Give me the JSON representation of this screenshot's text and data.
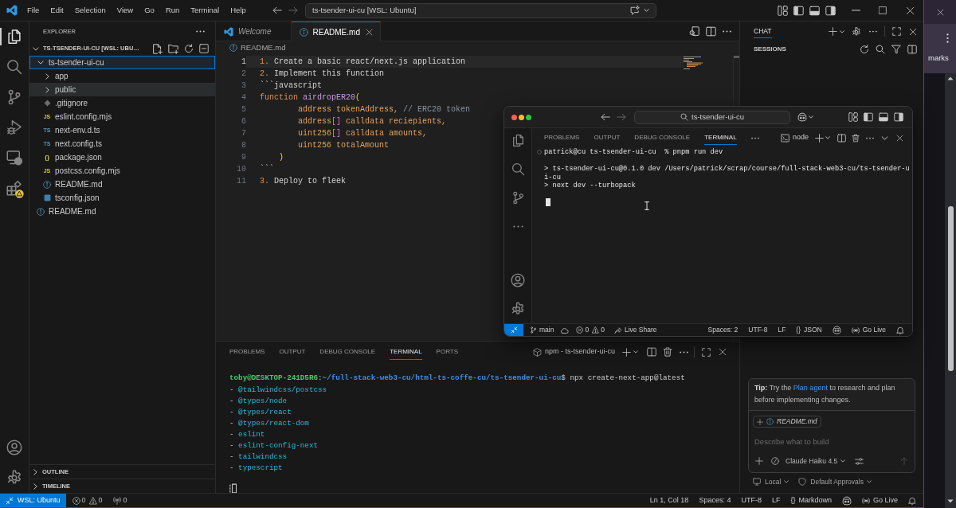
{
  "title_bar": {
    "menu": [
      "File",
      "Edit",
      "Selection",
      "View",
      "Go",
      "Run",
      "Terminal",
      "Help"
    ],
    "command_center": "ts-tsender-ui-cu [WSL: Ubuntu]"
  },
  "activity_bar": {
    "top": [
      {
        "kind": "explorer",
        "selected": true,
        "warning": false
      },
      {
        "kind": "search",
        "selected": false,
        "warning": false
      },
      {
        "kind": "source-control",
        "selected": false,
        "warning": false
      },
      {
        "kind": "run-debug",
        "selected": false,
        "warning": false
      },
      {
        "kind": "remote-explorer",
        "selected": false,
        "warning": false
      },
      {
        "kind": "extensions",
        "selected": false,
        "warning": true
      }
    ],
    "bottom": [
      {
        "kind": "account"
      },
      {
        "kind": "settings"
      }
    ]
  },
  "explorer": {
    "title": "EXPLORER",
    "workspace": {
      "label": "TS-TSENDER-UI-CU [WSL: UBU…",
      "expanded": true
    },
    "tree": [
      {
        "label": "ts-tsender-ui-cu",
        "kind": "folder",
        "expanded": true,
        "selected": true,
        "hovered": false,
        "children": [
          {
            "label": "app",
            "kind": "folder",
            "expanded": false,
            "selected": false,
            "hovered": false
          },
          {
            "label": "public",
            "kind": "folder",
            "expanded": false,
            "selected": false,
            "hovered": true
          },
          {
            "label": ".gitignore",
            "kind": "git",
            "selected": false,
            "hovered": false
          },
          {
            "label": "eslint.config.mjs",
            "kind": "js",
            "badge": "JS",
            "selected": false,
            "hovered": false
          },
          {
            "label": "next-env.d.ts",
            "kind": "ts",
            "badge": "TS",
            "selected": false,
            "hovered": false
          },
          {
            "label": "next.config.ts",
            "kind": "ts",
            "badge": "TS",
            "selected": false,
            "hovered": false
          },
          {
            "label": "package.json",
            "kind": "json",
            "badge": "{}",
            "selected": false,
            "hovered": false
          },
          {
            "label": "postcss.config.mjs",
            "kind": "js",
            "badge": "JS",
            "selected": false,
            "hovered": false
          },
          {
            "label": "README.md",
            "kind": "info",
            "selected": false,
            "hovered": false
          },
          {
            "label": "tsconfig.json",
            "kind": "tsconfig",
            "selected": false,
            "hovered": false
          }
        ]
      },
      {
        "label": "README.md",
        "kind": "info",
        "selected": false,
        "hovered": false
      }
    ],
    "sections": [
      {
        "label": "OUTLINE",
        "expanded": false
      },
      {
        "label": "TIMELINE",
        "expanded": false
      }
    ]
  },
  "editor": {
    "tabs": [
      {
        "label": "Welcome",
        "kind": "welcome",
        "preview": true,
        "selected": false
      },
      {
        "label": "README.md",
        "kind": "info",
        "preview": false,
        "selected": true
      }
    ],
    "breadcrumb": "README.md",
    "lines": [
      {
        "number": "1",
        "current": true,
        "tokens": [
          {
            "text": "1.",
            "kind": "marker"
          },
          {
            "text": " Create a basic react/next.js application",
            "kind": "text"
          }
        ]
      },
      {
        "number": "2",
        "current": false,
        "tokens": [
          {
            "text": "2.",
            "kind": "marker"
          },
          {
            "text": " Implement this function",
            "kind": "text"
          }
        ]
      },
      {
        "number": "3",
        "current": false,
        "tokens": [
          {
            "text": "```javascript",
            "kind": "text"
          }
        ]
      },
      {
        "number": "4",
        "current": false,
        "tokens": [
          {
            "text": "function",
            "kind": "keyword"
          },
          {
            "text": " airdropER20",
            "kind": "function"
          },
          {
            "text": "(",
            "kind": "paren"
          }
        ]
      },
      {
        "number": "5",
        "current": false,
        "tokens": [
          {
            "text": "        address tokenAddress,",
            "kind": "type"
          },
          {
            "text": " // ERC20 token",
            "kind": "comment"
          }
        ]
      },
      {
        "number": "6",
        "current": false,
        "tokens": [
          {
            "text": "        address",
            "kind": "type"
          },
          {
            "text": "[]",
            "kind": "bracket"
          },
          {
            "text": " calldata reciepients,",
            "kind": "type"
          }
        ]
      },
      {
        "number": "7",
        "current": false,
        "tokens": [
          {
            "text": "        uint256",
            "kind": "type"
          },
          {
            "text": "[]",
            "kind": "bracket"
          },
          {
            "text": " calldata amounts,",
            "kind": "type"
          }
        ]
      },
      {
        "number": "8",
        "current": false,
        "tokens": [
          {
            "text": "        uint256 totalAmount",
            "kind": "type"
          }
        ]
      },
      {
        "number": "9",
        "current": false,
        "tokens": [
          {
            "text": "    )",
            "kind": "paren"
          }
        ]
      },
      {
        "number": "10",
        "current": false,
        "tokens": [
          {
            "text": "```",
            "kind": "text"
          }
        ]
      },
      {
        "number": "11",
        "current": false,
        "tokens": [
          {
            "text": "3.",
            "kind": "marker"
          },
          {
            "text": " Deploy to fleek",
            "kind": "text"
          }
        ]
      }
    ]
  },
  "panel": {
    "tabs": [
      {
        "label": "PROBLEMS",
        "selected": false
      },
      {
        "label": "OUTPUT",
        "selected": false
      },
      {
        "label": "DEBUG CONSOLE",
        "selected": false
      },
      {
        "label": "TERMINAL",
        "selected": true
      },
      {
        "label": "PORTS",
        "selected": false
      }
    ],
    "terminal_name": "npm - ts-tsender-ui-cu",
    "lines": [
      {
        "tokens": [
          {
            "text": "toby@DESKTOP-241D5R6",
            "kind": "user"
          },
          {
            "text": ":",
            "kind": "plain"
          },
          {
            "text": "~/full-stack-web3-cu/html-ts-coffe-cu/ts-tsender-ui-cu",
            "kind": "path"
          },
          {
            "text": "$ npx create-next-app@latest",
            "kind": "plain"
          }
        ]
      },
      {
        "tokens": [
          {
            "text": "- ",
            "kind": "plain"
          },
          {
            "text": "@tailwindcss/postcss",
            "kind": "package"
          }
        ]
      },
      {
        "tokens": [
          {
            "text": "- ",
            "kind": "plain"
          },
          {
            "text": "@types/node",
            "kind": "package"
          }
        ]
      },
      {
        "tokens": [
          {
            "text": "- ",
            "kind": "plain"
          },
          {
            "text": "@types/react",
            "kind": "package"
          }
        ]
      },
      {
        "tokens": [
          {
            "text": "- ",
            "kind": "plain"
          },
          {
            "text": "@types/react-dom",
            "kind": "package"
          }
        ]
      },
      {
        "tokens": [
          {
            "text": "- ",
            "kind": "plain"
          },
          {
            "text": "eslint",
            "kind": "package"
          }
        ]
      },
      {
        "tokens": [
          {
            "text": "- ",
            "kind": "plain"
          },
          {
            "text": "eslint-config-next",
            "kind": "package"
          }
        ]
      },
      {
        "tokens": [
          {
            "text": "- ",
            "kind": "plain"
          },
          {
            "text": "tailwindcss",
            "kind": "package"
          }
        ]
      },
      {
        "tokens": [
          {
            "text": "- ",
            "kind": "plain"
          },
          {
            "text": "typescript",
            "kind": "package"
          }
        ]
      }
    ]
  },
  "chat": {
    "tabs": [
      {
        "label": "CHAT",
        "selected": true
      }
    ],
    "sessions": "SESSIONS",
    "tip": {
      "text": "**Tip:** Try the",
      "link": "Plan agent",
      "after": "to research and plan before implementing changes."
    },
    "input": {
      "attachment": "README.md",
      "placeholder": "Describe what to build",
      "model": "Claude Haiku 4.5"
    },
    "footer": [
      {
        "kind": "local",
        "label": "Local"
      },
      {
        "kind": "approvals",
        "label": "Default Approvals"
      }
    ]
  },
  "status_bar": {
    "remote": "WSL: Ubuntu",
    "errors": "0",
    "warnings": "0",
    "ports": "0",
    "right": [
      {
        "kind": "text",
        "text": "Ln 1, Col 18"
      },
      {
        "kind": "text",
        "text": "Spaces: 4"
      },
      {
        "kind": "text",
        "text": "UTF-8"
      },
      {
        "kind": "text",
        "text": "LF"
      },
      {
        "kind": "language",
        "glyph": "{}",
        "text": "Markdown"
      },
      {
        "kind": "copilot"
      },
      {
        "kind": "golive",
        "text": "Go Live"
      },
      {
        "kind": "bell"
      }
    ]
  },
  "floating_window": {
    "search": "ts-tsender-ui-cu",
    "activity_top": [
      {
        "kind": "explorer"
      },
      {
        "kind": "search"
      },
      {
        "kind": "source-control"
      },
      {
        "kind": "more"
      }
    ],
    "activity_bottom": [
      {
        "kind": "account"
      },
      {
        "kind": "settings"
      }
    ],
    "panel_tabs": [
      {
        "label": "PROBLEMS",
        "selected": false
      },
      {
        "label": "OUTPUT",
        "selected": false
      },
      {
        "label": "DEBUG CONSOLE",
        "selected": false
      },
      {
        "label": "TERMINAL",
        "selected": true
      }
    ],
    "terminal_name": "node",
    "lines": [
      {
        "kind": "command",
        "text": "patrick@cu ts-tsender-ui-cu  % pnpm run dev"
      },
      {
        "kind": "output",
        "text": "> ts-tsender-ui-cu@0.1.0 dev /Users/patrick/scrap/course/full-stack-web3-cu/ts-tsender-u"
      },
      {
        "kind": "output",
        "text": "i-cu"
      },
      {
        "kind": "output",
        "text": "> next dev --turbopack"
      }
    ],
    "status_bar": {
      "branch": "main",
      "errors": "0",
      "warnings": "0",
      "live_share": "Live Share",
      "right": [
        {
          "kind": "text",
          "text": "Spaces: 2"
        },
        {
          "kind": "text",
          "text": "UTF-8"
        },
        {
          "kind": "text",
          "text": "LF"
        },
        {
          "kind": "language",
          "glyph": "{}",
          "text": "JSON"
        },
        {
          "kind": "copilot"
        },
        {
          "kind": "golive",
          "text": "Go Live"
        },
        {
          "kind": "bell"
        }
      ]
    }
  },
  "background_window": {
    "label": "marks"
  }
}
